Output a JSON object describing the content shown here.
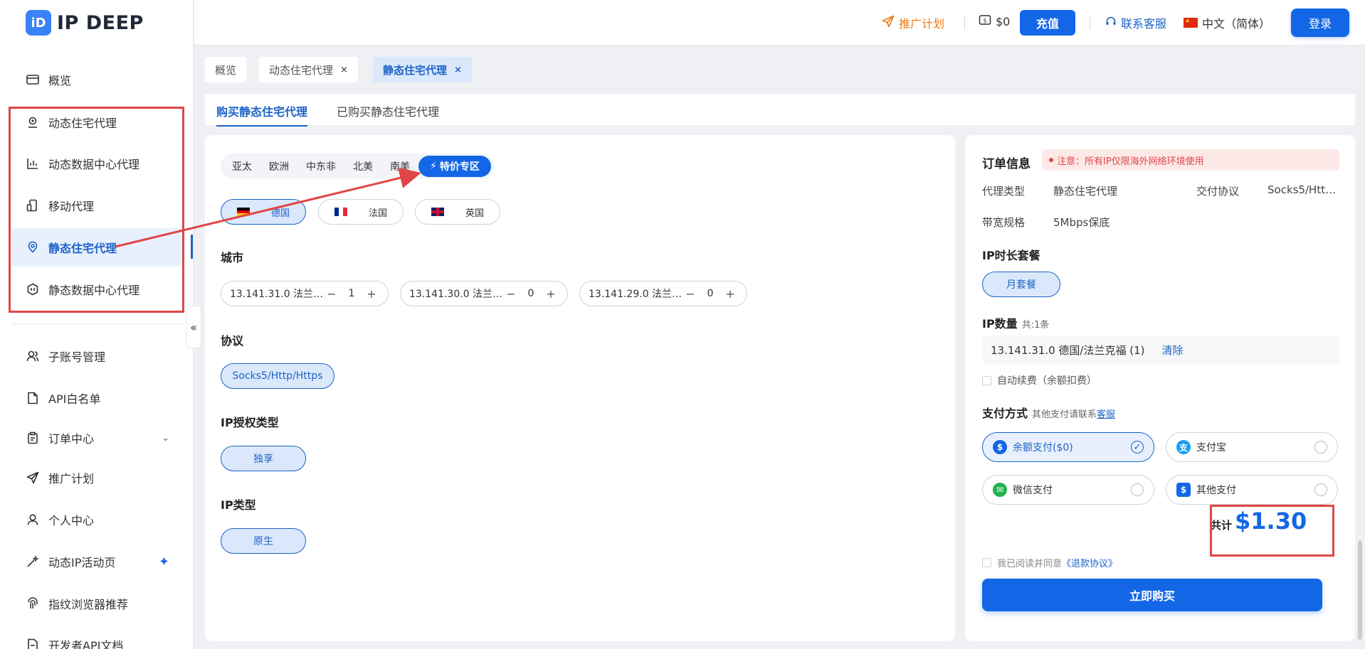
{
  "app": {
    "brand_mark": "iD",
    "brand_name": "IP DEEP"
  },
  "header": {
    "promo": "推广计划",
    "balance": "$0",
    "recharge": "充值",
    "support": "联系客服",
    "language": "中文（简体）",
    "login": "登录"
  },
  "sidebar": {
    "items": [
      {
        "label": "概览",
        "icon": "overview-icon"
      },
      {
        "label": "动态住宅代理",
        "icon": "location-icon"
      },
      {
        "label": "动态数据中心代理",
        "icon": "chart-icon"
      },
      {
        "label": "移动代理",
        "icon": "mobile-icon"
      },
      {
        "label": "静态住宅代理",
        "icon": "pin-icon",
        "active": true
      },
      {
        "label": "静态数据中心代理",
        "icon": "datacenter-icon"
      },
      {
        "label": "子账号管理",
        "icon": "users-icon"
      },
      {
        "label": "API白名单",
        "icon": "document-icon"
      },
      {
        "label": "订单中心",
        "icon": "clipboard-icon",
        "expand": "⌄"
      },
      {
        "label": "推广计划",
        "icon": "send-icon"
      },
      {
        "label": "个人中心",
        "icon": "user-icon"
      },
      {
        "label": "动态IP活动页",
        "icon": "wand-icon",
        "badge": "✦"
      },
      {
        "label": "指纹浏览器推荐",
        "icon": "fingerprint-icon"
      },
      {
        "label": "开发者API文档",
        "icon": "api-doc-icon"
      }
    ],
    "collapse": "«"
  },
  "page_tabs": [
    {
      "label": "概览"
    },
    {
      "label": "动态住宅代理",
      "close": "×"
    },
    {
      "label": "静态住宅代理",
      "close": "×",
      "active": true
    }
  ],
  "subtabs": [
    {
      "label": "购买静态住宅代理",
      "active": true
    },
    {
      "label": "已购买静态住宅代理"
    }
  ],
  "main": {
    "regions": [
      "亚太",
      "欧洲",
      "中东非",
      "北美",
      "南美"
    ],
    "special": "特价专区",
    "countries": [
      {
        "label": "德国",
        "flag": "de",
        "active": true
      },
      {
        "label": "法国",
        "flag": "fr"
      },
      {
        "label": "英国",
        "flag": "gb"
      }
    ],
    "city_label": "城市",
    "cities": [
      {
        "name": "13.141.31.0 法兰…",
        "qty": "1"
      },
      {
        "name": "13.141.30.0 法兰…",
        "qty": "0"
      },
      {
        "name": "13.141.29.0 法兰…",
        "qty": "0"
      }
    ],
    "minus": "−",
    "plus": "+",
    "protocol_label": "协议",
    "protocol": "Socks5/Http/Https",
    "auth_label": "IP授权类型",
    "auth": "独享",
    "iptype_label": "IP类型",
    "iptype": "原生"
  },
  "order": {
    "title": "订单信息",
    "notice": "注意：所有IP仅限海外网络环境使用",
    "proxy_type_label": "代理类型",
    "proxy_type": "静态住宅代理",
    "protocol_label": "交付协议",
    "protocol": "Socks5/Htt…",
    "bandwidth_label": "带宽规格",
    "bandwidth": "5Mbps保底",
    "duration_label": "IP时长套餐",
    "duration": "月套餐",
    "ip_count_label": "IP数量",
    "ip_count": "共:1条",
    "ip_item": "13.141.31.0 德国/法兰克福 (1)",
    "clear": "清除",
    "auto_renew": "自动续费（余额扣费）",
    "payment_label": "支付方式",
    "payment_hint": "其他支付请联系",
    "payment_link": "客服",
    "payments": [
      {
        "label": "余额支付($0)",
        "active": true,
        "mark": "✓"
      },
      {
        "label": "支付宝"
      },
      {
        "label": "微信支付"
      },
      {
        "label": "其他支付"
      }
    ],
    "total_label": "共计",
    "total": "$1.30",
    "agree": "我已阅读并同意",
    "agree_link": "《退款协议》",
    "buy": "立即购买"
  },
  "colors": {
    "primary": "#1367e6",
    "accent": "#1d63c6",
    "annotation": "#e04646",
    "promo": "#f07a13"
  }
}
